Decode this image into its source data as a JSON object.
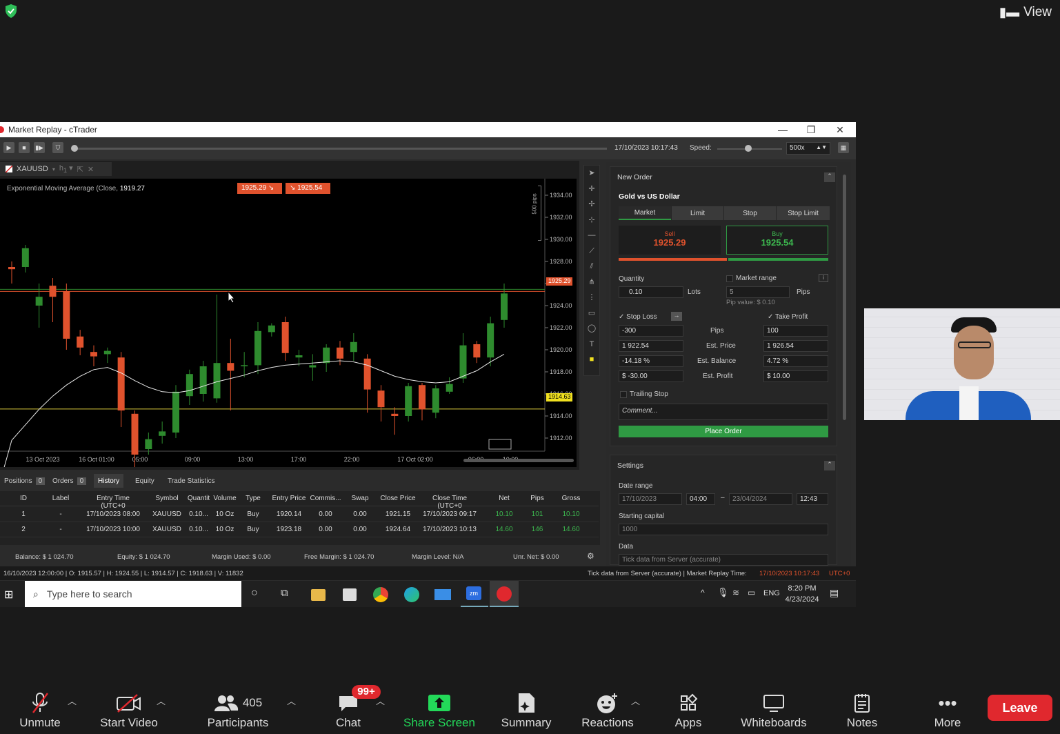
{
  "top": {
    "view_label": "View"
  },
  "window": {
    "title": "Market Replay - cTrader"
  },
  "replay": {
    "datetime": "17/10/2023 10:17:43",
    "speed_label": "Speed:",
    "speed_value": "500x"
  },
  "chart": {
    "symbol": "XAUUSD",
    "timeframe": "h1",
    "indicator_label": "Exponential Moving Average (Close, ",
    "indicator_value": "1919.27",
    "sell_chip": "1925.29",
    "buy_chip": "1925.54",
    "pips_label": "500 pips",
    "bid_tag": "1925.29",
    "line_tag": "1914.63"
  },
  "chart_data": {
    "type": "candlestick",
    "symbol": "XAUUSD",
    "y_ticks": [
      "1934.00",
      "1932.00",
      "1930.00",
      "1928.00",
      "1926.00",
      "1924.00",
      "1922.00",
      "1920.00",
      "1918.00",
      "1916.00",
      "1914.00",
      "1912.00"
    ],
    "x_ticks": [
      "13 Oct 2023",
      "16 Oct 01:00",
      "05:00",
      "09:00",
      "13:00",
      "17:00",
      "22:00",
      "17 Oct 02:00",
      "06:00",
      "10:00"
    ],
    "ylim": [
      1911,
      1935
    ],
    "candles": [
      [
        1927.5,
        1927.3,
        1928,
        1926
      ],
      [
        1927.5,
        1929.2,
        1929.5,
        1927
      ],
      [
        1924,
        1924.8,
        1926,
        1922
      ],
      [
        1925.8,
        1924.8,
        1926.5,
        1922.5
      ],
      [
        1925.3,
        1921,
        1926,
        1920
      ],
      [
        1921.2,
        1920.2,
        1921.8,
        1919.5
      ],
      [
        1919.8,
        1919.4,
        1920.4,
        1918.5
      ],
      [
        1919.6,
        1919.9,
        1920.2,
        1918.8
      ],
      [
        1919.3,
        1914.5,
        1919.8,
        1913
      ],
      [
        1914.2,
        1910.5,
        1914.5,
        1909
      ],
      [
        1911,
        1911.9,
        1912.5,
        1910.5
      ],
      [
        1912.2,
        1912.6,
        1913.5,
        1911.5
      ],
      [
        1912.5,
        1916.2,
        1916.8,
        1912
      ],
      [
        1915.8,
        1917.8,
        1918.2,
        1915
      ],
      [
        1916,
        1918.5,
        1919,
        1915.3
      ],
      [
        1915.6,
        1918.8,
        1925,
        1915.2
      ],
      [
        1918.8,
        1918.1,
        1921,
        1914.5
      ],
      [
        1918.5,
        1918.6,
        1919.8,
        1917.5
      ],
      [
        1918.6,
        1921.7,
        1922.5,
        1917.8
      ],
      [
        1921.6,
        1922.2,
        1922.4,
        1921.2
      ],
      [
        1922.5,
        1919.7,
        1923,
        1919
      ],
      [
        1919.3,
        1919.5,
        1920,
        1918.5
      ],
      [
        1918.4,
        1918.6,
        1919.6,
        1917.2
      ],
      [
        1918.8,
        1920.2,
        1920.5,
        1918
      ],
      [
        1920.2,
        1919.2,
        1920.8,
        1918.6
      ],
      [
        1919.8,
        1920.7,
        1921.5,
        1919
      ],
      [
        1919.2,
        1916.4,
        1919.6,
        1914.3
      ],
      [
        1916.3,
        1914.8,
        1916.8,
        1913.5
      ],
      [
        1914.2,
        1914,
        1914.8,
        1912.3
      ],
      [
        1914,
        1916.7,
        1917,
        1913.5
      ],
      [
        1916.8,
        1914.6,
        1917,
        1913.6
      ],
      [
        1914.3,
        1916.5,
        1916.8,
        1913.8
      ],
      [
        1916.2,
        1916.9,
        1917.5,
        1916
      ],
      [
        1917.4,
        1920.4,
        1921.5,
        1917
      ],
      [
        1920.5,
        1919.3,
        1920.8,
        1918.8
      ],
      [
        1919.3,
        1922.4,
        1923,
        1918.5
      ],
      [
        1922.7,
        1925.1,
        1926,
        1922
      ]
    ],
    "ema": [
      1911.8,
      1913.2,
      1914.6,
      1915.8,
      1916.8,
      1917.6,
      1918.2,
      1918.4,
      1917.9,
      1917.2,
      1916.6,
      1916.2,
      1916.1,
      1916.3,
      1916.7,
      1917.1,
      1917.4,
      1917.7,
      1918.1,
      1918.4,
      1918.6,
      1918.7,
      1918.8,
      1918.9,
      1919,
      1918.9,
      1918.6,
      1918.1,
      1917.6,
      1917.3,
      1917.1,
      1917,
      1917.1,
      1917.6,
      1918.1,
      1918.9,
      1919.6
    ]
  },
  "order": {
    "header": "New Order",
    "instrument": "Gold vs US Dollar",
    "types": [
      "Market",
      "Limit",
      "Stop",
      "Stop Limit"
    ],
    "sell_label": "Sell",
    "sell_price": "1925.29",
    "buy_label": "Buy",
    "buy_price": "1925.54",
    "quantity_label": "Quantity",
    "quantity": "0.10",
    "lots": "Lots",
    "market_range": "Market range",
    "range_value": "5",
    "pips": "Pips",
    "pip_value": "Pip value: $ 0.10",
    "stop_loss": "Stop Loss",
    "take_profit": "Take Profit",
    "sl_pips": "-300",
    "sl_price": "1 922.54",
    "sl_balance": "-14.18 %",
    "sl_profit": "$ -30.00",
    "row_pips": "Pips",
    "row_price": "Est. Price",
    "row_balance": "Est. Balance",
    "row_profit": "Est. Profit",
    "tp_pips": "100",
    "tp_price": "1 926.54",
    "tp_balance": "4.72 %",
    "tp_profit": "$ 10.00",
    "trailing": "Trailing Stop",
    "comment_placeholder": "Comment...",
    "place": "Place Order"
  },
  "settings": {
    "header": "Settings",
    "date_range": "Date range",
    "from_date": "17/10/2023",
    "from_time": "04:00",
    "to_date": "23/04/2024",
    "to_time": "12:43",
    "capital_label": "Starting capital",
    "capital": "1000",
    "data_label": "Data",
    "data_value": "Tick data from Server (accurate)"
  },
  "tabs": {
    "positions": "Positions",
    "positions_count": "0",
    "orders": "Orders",
    "orders_count": "0",
    "history": "History",
    "equity": "Equity",
    "stats": "Trade Statistics"
  },
  "history": {
    "columns": [
      "ID",
      "Label",
      "Entry Time (UTC+0",
      "Symbol",
      "Quantit",
      "Volume",
      "Type",
      "Entry Price",
      "Commis...",
      "Swap",
      "Close Price",
      "Close Time (UTC+0",
      "Net",
      "Pips",
      "Gross"
    ],
    "rows": [
      [
        "1",
        "-",
        "17/10/2023 08:00",
        "XAUUSD",
        "0.10...",
        "10 Oz",
        "Buy",
        "1920.14",
        "0.00",
        "0.00",
        "1921.15",
        "17/10/2023 09:17",
        "10.10",
        "101",
        "10.10"
      ],
      [
        "2",
        "-",
        "17/10/2023 10:00",
        "XAUUSD",
        "0.10...",
        "10 Oz",
        "Buy",
        "1923.18",
        "0.00",
        "0.00",
        "1924.64",
        "17/10/2023 10:13",
        "14.60",
        "146",
        "14.60"
      ]
    ]
  },
  "balance": {
    "balance": "Balance: $ 1 024.70",
    "equity": "Equity: $ 1 024.70",
    "margin_used": "Margin Used: $ 0.00",
    "free_margin": "Free Margin: $ 1 024.70",
    "margin_level": "Margin Level: N/A",
    "unr_net": "Unr. Net: $ 0.00"
  },
  "status": {
    "ohlc": "16/10/2023 12:00:00 | O: 1915.57 | H: 1924.55 | L: 1914.57 | C: 1918.63 | V: 11832",
    "source": "Tick data from Server (accurate) | Market Replay Time:",
    "replay_time": "17/10/2023 10:17:43",
    "tz": "UTC+0"
  },
  "taskbar": {
    "search_placeholder": "Type here to search",
    "lang": "ENG",
    "time": "8:20 PM",
    "date": "4/23/2024"
  },
  "zoom": {
    "unmute": "Unmute",
    "video": "Start Video",
    "participants": "Participants",
    "participants_count": "405",
    "chat": "Chat",
    "chat_badge": "99+",
    "share": "Share Screen",
    "summary": "Summary",
    "reactions": "Reactions",
    "apps": "Apps",
    "whiteboards": "Whiteboards",
    "notes": "Notes",
    "more": "More",
    "leave": "Leave"
  },
  "colors": {
    "bull": "#2e8b2e",
    "bear": "#e0522d",
    "share_green": "#23d959",
    "leave_red": "#e0282e",
    "order_green": "#2f9a43"
  }
}
